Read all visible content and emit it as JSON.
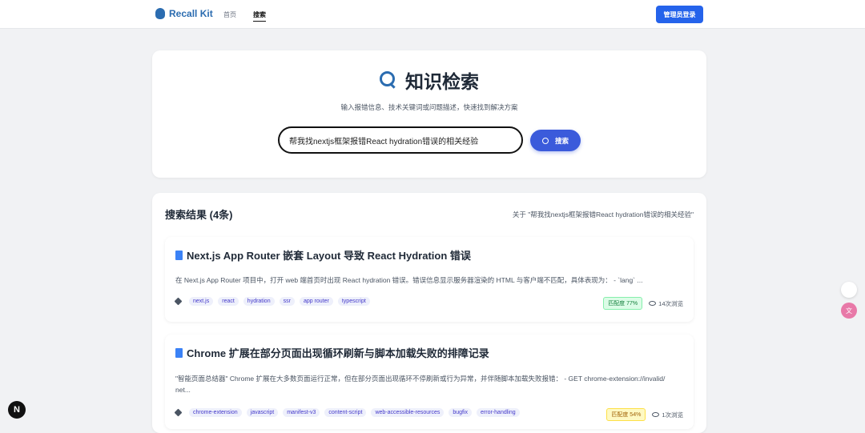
{
  "header": {
    "brand": "Recall Kit",
    "nav": [
      "首页",
      "搜索"
    ],
    "admin_login": "管理员登录"
  },
  "search": {
    "title": "知识检索",
    "subtitle": "输入报错信息、技术关键词或问题描述，快速找到解决方案",
    "query": "帮我找nextjs框架报错React hydration错误的相关经验",
    "button": "搜索"
  },
  "results": {
    "heading": "搜索结果 (4条)",
    "about": "关于 \"帮我找nextjs框架报错React hydration错误的相关经验\"",
    "items": [
      {
        "title": "Next.js App Router 嵌套 Layout 导致 React Hydration 错误",
        "desc": "在 Next.js App Router 项目中，打开 web 端首页时出现 React hydration 错误。错误信息显示服务器渲染的 HTML 与客户端不匹配，具体表现为： - `lang` ...",
        "tags": [
          "next.js",
          "react",
          "hydration",
          "ssr",
          "app router",
          "typescript"
        ],
        "match": "匹配度 77%",
        "views": "14次浏览"
      },
      {
        "title": "Chrome 扩展在部分页面出现循环刷新与脚本加载失败的排障记录",
        "desc": "\"智能页面总结器\" Chrome 扩展在大多数页面运行正常，但在部分页面出现循环不停刷新或行为异常，并伴随脚本加载失败报错： - GET chrome-extension://invalid/ net...",
        "tags": [
          "chrome-extension",
          "javascript",
          "manifest-v3",
          "content-script",
          "web-accessible-resources",
          "bugfix",
          "error-handling"
        ],
        "match": "匹配度 54%",
        "views": "1次浏览"
      }
    ]
  },
  "floating": {
    "translate": "文",
    "next": "N"
  },
  "colors": {
    "accent": "#3b5bdb",
    "brand": "#2b6cb0"
  }
}
